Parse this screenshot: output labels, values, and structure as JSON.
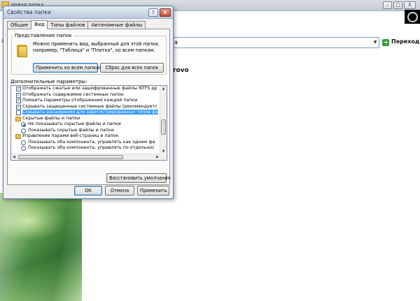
{
  "background": {
    "window_title": "Новая папка",
    "address_value": "а",
    "go_label": "Переход",
    "heading": "rovo",
    "left_mark": "д",
    "controls": {
      "minimize": "–",
      "maximize": "□",
      "close": "X"
    }
  },
  "dialog": {
    "title": "Свойства папки",
    "help": "?",
    "close": "X",
    "tabs": [
      "Общие",
      "Вид",
      "Типы файлов",
      "Автономные файлы"
    ],
    "active_tab": "Вид",
    "folder_views": {
      "label": "Представление папок",
      "description": "Можно применить вид, выбранный для этой папки, например, \"Таблица\" и \"Плитка\", ко всем папкам.",
      "apply_all": "Применить ко всем папкам",
      "reset_all": "Сброс для всех папок"
    },
    "advanced": {
      "label": "Дополнительные параметры:",
      "items": [
        {
          "kind": "check",
          "checked": true,
          "text": "Отображать сжатые или зашифрованные файлы NTFS др"
        },
        {
          "kind": "check",
          "checked": true,
          "text": "Отображать содержимое системных папок"
        },
        {
          "kind": "check",
          "checked": true,
          "text": "Помнить параметры отображения каждой папки"
        },
        {
          "kind": "check",
          "checked": true,
          "text": "Скрывать защищенные системные файлы (рекомендуетс"
        },
        {
          "kind": "check",
          "checked": false,
          "selected": true,
          "text": "Скрывать расширения для зарегистрированных типов фа"
        },
        {
          "kind": "folder",
          "text": "Скрытые файлы и папки"
        },
        {
          "kind": "radio",
          "checked": true,
          "text": "Не показывать скрытые файлы и папки"
        },
        {
          "kind": "radio",
          "checked": false,
          "text": "Показывать скрытые файлы и папки"
        },
        {
          "kind": "folder",
          "text": "Управление парами веб-страниц и папок"
        },
        {
          "kind": "radio",
          "checked": false,
          "text": "Показывать оба компонента, управлять как одним фа"
        },
        {
          "kind": "radio",
          "checked": false,
          "text": "Показывать оба компонента, управлять по отдельнос"
        }
      ]
    },
    "restore_defaults": "Восстановить умолчания",
    "ok": "ОК",
    "cancel": "Отмена",
    "apply": "Применить"
  }
}
